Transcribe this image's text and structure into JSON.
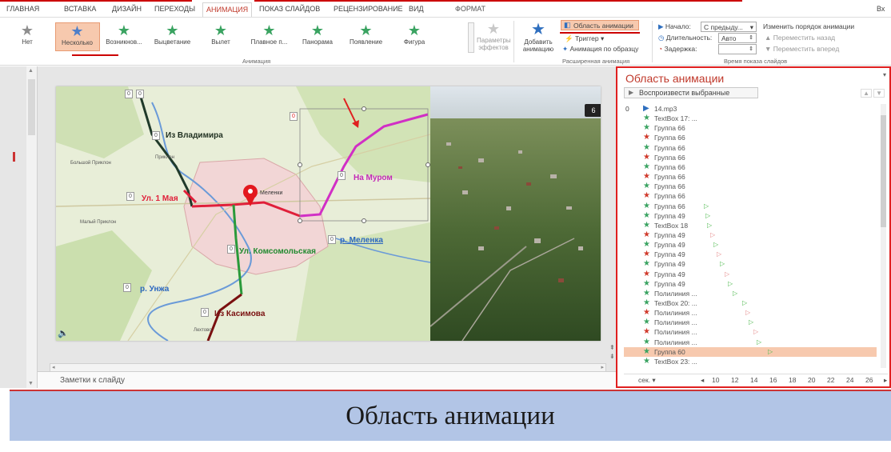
{
  "ribbon_tabs": [
    "ГЛАВНАЯ",
    "ВСТАВКА",
    "ДИЗАЙН",
    "ПЕРЕХОДЫ",
    "АНИМАЦИЯ",
    "ПОКАЗ СЛАЙДОВ",
    "РЕЦЕНЗИРОВАНИЕ",
    "ВИД",
    "ФОРМАТ"
  ],
  "account_short": "Вх",
  "animations": [
    {
      "label": "Нет",
      "color": "#8e8e8e"
    },
    {
      "label": "Несколько",
      "color": "#4f7fc9"
    },
    {
      "label": "Возникнов...",
      "color": "#3aa361"
    },
    {
      "label": "Выцветание",
      "color": "#3aa361"
    },
    {
      "label": "Вылет",
      "color": "#3aa361"
    },
    {
      "label": "Плавное п...",
      "color": "#3aa361"
    },
    {
      "label": "Панорама",
      "color": "#3aa361"
    },
    {
      "label": "Появление",
      "color": "#3aa361"
    },
    {
      "label": "Фигура",
      "color": "#3aa361"
    }
  ],
  "effect_params": "Параметры эффектов",
  "group_animation": "Анимация",
  "add_animation": "Добавить анимацию",
  "anim_pane_btn": "Область анимации",
  "trigger": "Триггер",
  "anim_painter": "Анимация по образцу",
  "group_advanced": "Расширенная анимация",
  "start_label": "Начало:",
  "start_value": "С предыду...",
  "duration_label": "Длительность:",
  "duration_value": "Авто",
  "delay_label": "Задержка:",
  "reorder_title": "Изменить порядок анимации",
  "move_back": "Переместить назад",
  "move_forward": "Переместить вперед",
  "group_timing": "Время показа слайдов",
  "notes_label": "Заметки к слайду",
  "map_labels": {
    "vladimir": "Из Владимира",
    "murom": "На Муром",
    "may": "Ул. 1 Мая",
    "komsomol": "Ул. Комсомольская",
    "melenka_river": "р. Меленка",
    "unzha": "р. Унжа",
    "kasimov": "Из Касимова",
    "melenki": "Меленки",
    "bolshoy": "Большой Приклон",
    "priklon": "Приклон",
    "maly": "Малый Приклон",
    "leshovo": "Лехтово"
  },
  "map_markers": [
    "0",
    "0",
    "0",
    "0",
    "0",
    "0",
    "0",
    "0",
    "0",
    "0",
    "0"
  ],
  "slide_badge": "6",
  "pane_title": "Область анимации",
  "play_selected": "Воспроизвести выбранные",
  "anim_items": [
    {
      "num": "0",
      "icon": "play",
      "name": "14.mp3",
      "tri": ""
    },
    {
      "num": "",
      "icon": "green",
      "name": "TextBox 17: ...",
      "tri": ""
    },
    {
      "num": "",
      "icon": "green",
      "name": "Группа 66",
      "tri": ""
    },
    {
      "num": "",
      "icon": "red",
      "name": "Группа 66",
      "tri": ""
    },
    {
      "num": "",
      "icon": "green",
      "name": "Группа 66",
      "tri": ""
    },
    {
      "num": "",
      "icon": "red",
      "name": "Группа 66",
      "tri": ""
    },
    {
      "num": "",
      "icon": "green",
      "name": "Группа 66",
      "tri": ""
    },
    {
      "num": "",
      "icon": "red",
      "name": "Группа 66",
      "tri": ""
    },
    {
      "num": "",
      "icon": "green",
      "name": "Группа 66",
      "tri": ""
    },
    {
      "num": "",
      "icon": "red",
      "name": "Группа 66",
      "tri": ""
    },
    {
      "num": "",
      "icon": "green",
      "name": "Группа 66",
      "tri": "g"
    },
    {
      "num": "",
      "icon": "green",
      "name": "Группа 49",
      "tri": "g"
    },
    {
      "num": "",
      "icon": "green",
      "name": "TextBox 18",
      "tri": "g"
    },
    {
      "num": "",
      "icon": "red",
      "name": "Группа 49",
      "tri": "r"
    },
    {
      "num": "",
      "icon": "green",
      "name": "Группа 49",
      "tri": "g"
    },
    {
      "num": "",
      "icon": "red",
      "name": "Группа 49",
      "tri": "r"
    },
    {
      "num": "",
      "icon": "green",
      "name": "Группа 49",
      "tri": "g"
    },
    {
      "num": "",
      "icon": "red",
      "name": "Группа 49",
      "tri": "r"
    },
    {
      "num": "",
      "icon": "green",
      "name": "Группа 49",
      "tri": "g"
    },
    {
      "num": "",
      "icon": "green",
      "name": "Полилиния ...",
      "tri": "g"
    },
    {
      "num": "",
      "icon": "green",
      "name": "TextBox 20: ...",
      "tri": "g"
    },
    {
      "num": "",
      "icon": "red",
      "name": "Полилиния ...",
      "tri": "r"
    },
    {
      "num": "",
      "icon": "green",
      "name": "Полилиния ...",
      "tri": "g"
    },
    {
      "num": "",
      "icon": "red",
      "name": "Полилиния ...",
      "tri": "r"
    },
    {
      "num": "",
      "icon": "green",
      "name": "Полилиния ...",
      "tri": "g"
    },
    {
      "num": "",
      "icon": "green",
      "name": "Группа 60",
      "tri": "g"
    },
    {
      "num": "",
      "icon": "green",
      "name": "TextBox 23: ...",
      "tri": ""
    }
  ],
  "timeline_unit": "сек.",
  "timeline_ticks": [
    "10",
    "12",
    "14",
    "16",
    "18",
    "20",
    "22",
    "24",
    "26"
  ],
  "caption": "Область анимации"
}
